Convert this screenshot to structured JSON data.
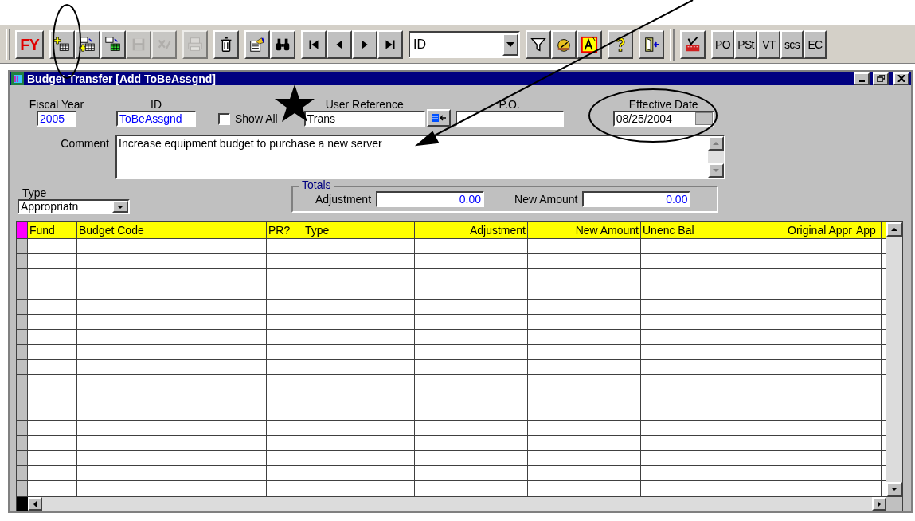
{
  "toolbar": {
    "groups": [
      [
        {
          "kind": "text",
          "label": "FY"
        }
      ],
      [
        {
          "kind": "icon",
          "disabled": false
        },
        {
          "kind": "icon",
          "disabled": false
        },
        {
          "kind": "icon",
          "disabled": false
        },
        {
          "kind": "icon",
          "disabled": true
        },
        {
          "kind": "icon",
          "disabled": true
        }
      ],
      [
        {
          "kind": "icon",
          "disabled": true
        }
      ],
      [
        {
          "kind": "icon",
          "disabled": false
        }
      ],
      [
        {
          "kind": "icon",
          "disabled": false
        },
        {
          "kind": "icon",
          "disabled": false
        }
      ],
      [
        {
          "kind": "icon",
          "disabled": false
        },
        {
          "kind": "icon",
          "disabled": false
        },
        {
          "kind": "icon",
          "disabled": false
        },
        {
          "kind": "icon",
          "disabled": false
        }
      ],
      [
        {
          "kind": "dropdown",
          "value": "ID"
        }
      ],
      [
        {
          "kind": "icon",
          "disabled": false
        },
        {
          "kind": "icon",
          "disabled": false
        },
        {
          "kind": "icon",
          "disabled": false
        }
      ],
      [
        {
          "kind": "icon",
          "disabled": false
        }
      ],
      [
        {
          "kind": "icon",
          "disabled": false
        }
      ],
      [
        {
          "kind": "separator"
        }
      ],
      [
        {
          "kind": "icon",
          "disabled": false
        }
      ],
      [
        {
          "kind": "text",
          "label": "PO"
        },
        {
          "kind": "text",
          "label": "PSt"
        },
        {
          "kind": "text",
          "label": "VT"
        },
        {
          "kind": "text",
          "label": "scs"
        },
        {
          "kind": "text",
          "label": "EC"
        }
      ]
    ]
  },
  "window": {
    "title": "Budget Transfer [Add ToBeAssgnd]"
  },
  "form": {
    "fiscal_year": {
      "label": "Fiscal Year",
      "value": "2005"
    },
    "id": {
      "label": "ID",
      "value": "ToBeAssgnd"
    },
    "show_all": {
      "label": "Show All",
      "checked": false
    },
    "user_reference": {
      "label": "User Reference",
      "value": "Trans"
    },
    "po": {
      "label": "P.O."
    },
    "effective_date": {
      "label": "Effective Date",
      "value": "08/25/2004"
    },
    "comment": {
      "label": "Comment",
      "value": "Increase equipment budget to purchase a new server"
    },
    "type": {
      "label": "Type",
      "value": "Appropriatn"
    },
    "totals": {
      "title": "Totals",
      "adjustment": {
        "label": "Adjustment",
        "value": "0.00"
      },
      "new_amount": {
        "label": "New Amount",
        "value": "0.00"
      }
    }
  },
  "grid": {
    "columns": [
      {
        "label": "Fund",
        "right_aligned": false
      },
      {
        "label": "Budget Code",
        "right_aligned": false
      },
      {
        "label": "PR?",
        "right_aligned": false
      },
      {
        "label": "Type",
        "right_aligned": false
      },
      {
        "label": "Adjustment",
        "right_aligned": true
      },
      {
        "label": "New Amount",
        "right_aligned": true
      },
      {
        "label": "Unenc Bal",
        "right_aligned": false
      },
      {
        "label": "Original Appr",
        "right_aligned": true
      },
      {
        "label": "App",
        "right_aligned": false
      }
    ]
  }
}
